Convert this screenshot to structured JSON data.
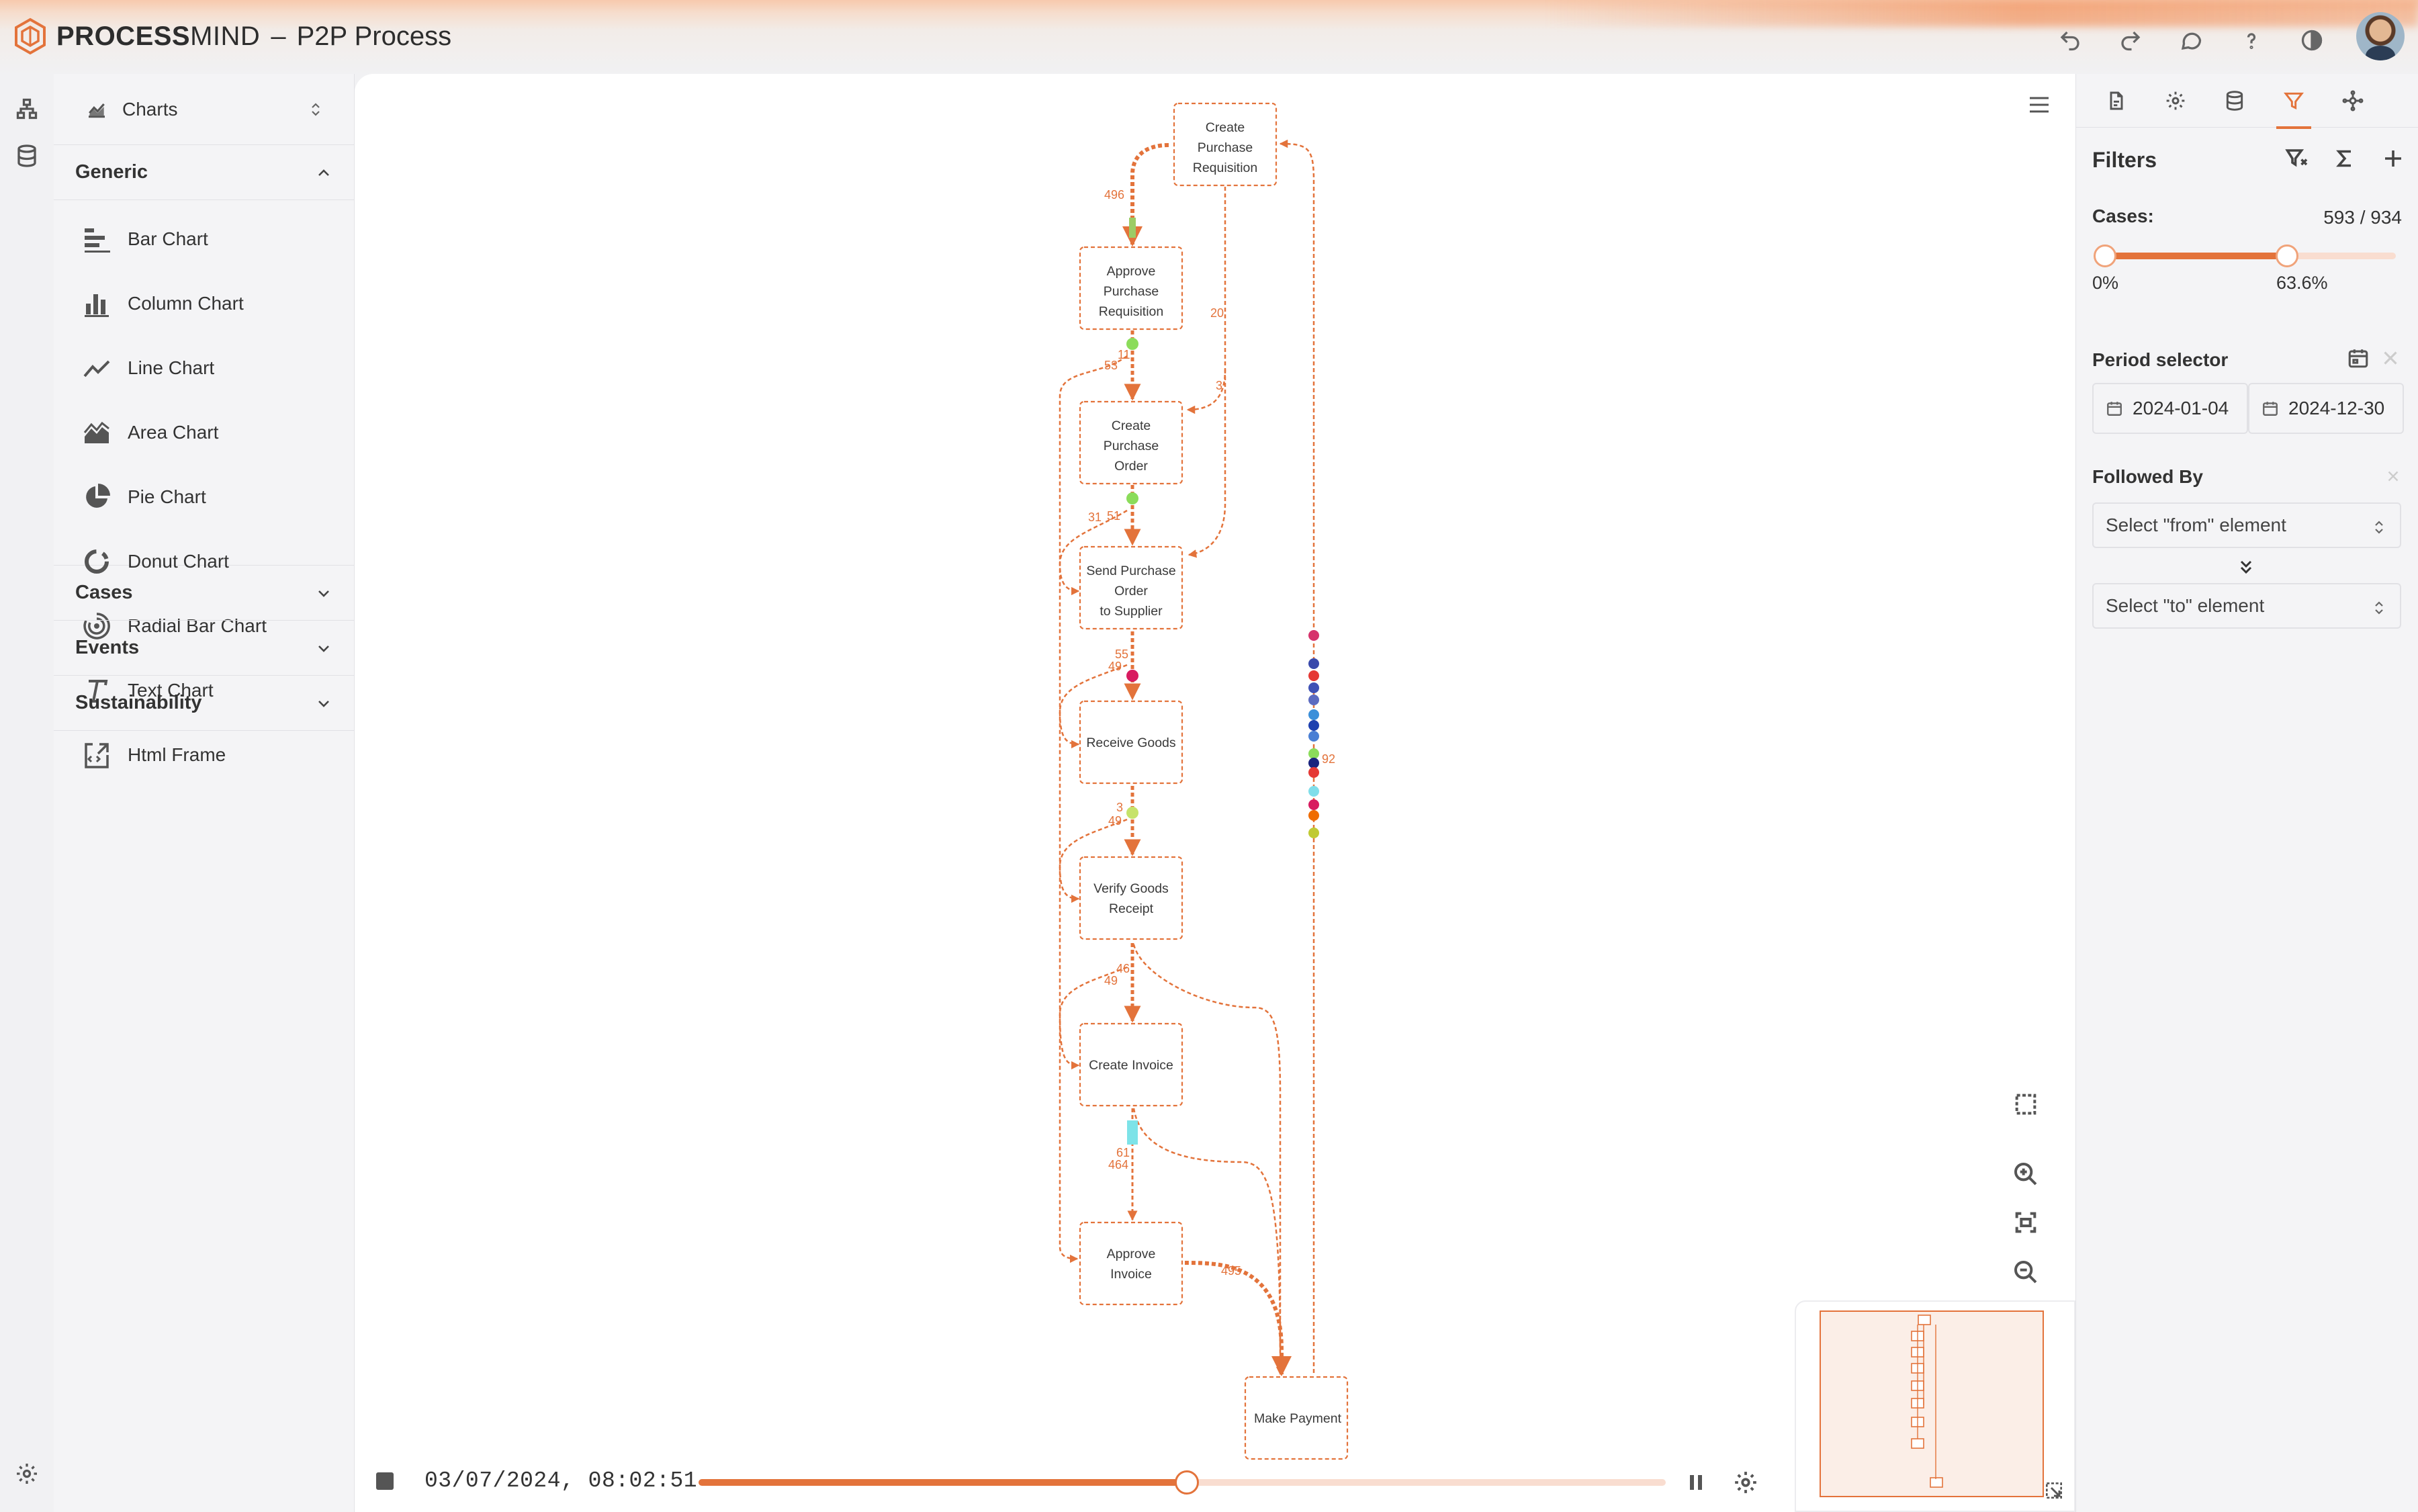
{
  "app": {
    "brand_bold": "PROCESS",
    "brand_rest": "MIND",
    "separator": "–",
    "title": "P2P Process"
  },
  "header_icons": [
    "undo-icon",
    "redo-icon",
    "comment-icon",
    "help-icon",
    "theme-icon"
  ],
  "sidebar": {
    "selector_label": "Charts",
    "generic_title": "Generic",
    "generic_items": [
      {
        "label": "Bar Chart",
        "icon": "bar-chart-icon"
      },
      {
        "label": "Column Chart",
        "icon": "column-chart-icon"
      },
      {
        "label": "Line Chart",
        "icon": "line-chart-icon"
      },
      {
        "label": "Area Chart",
        "icon": "area-chart-icon"
      },
      {
        "label": "Pie Chart",
        "icon": "pie-chart-icon"
      },
      {
        "label": "Donut Chart",
        "icon": "donut-chart-icon"
      },
      {
        "label": "Radial Bar Chart",
        "icon": "radial-bar-chart-icon"
      },
      {
        "label": "Text Chart",
        "icon": "text-chart-icon"
      },
      {
        "label": "Html Frame",
        "icon": "html-frame-icon"
      }
    ],
    "sections": [
      "Cases",
      "Events",
      "Sustainability"
    ]
  },
  "process_map": {
    "nodes": {
      "create_pr": [
        "Create",
        "Purchase",
        "Requisition"
      ],
      "approve_pr": [
        "Approve",
        "Purchase",
        "Requisition"
      ],
      "create_po": [
        "Create",
        "Purchase",
        "Order"
      ],
      "send_po": [
        "Send Purchase",
        "Order",
        "to Supplier"
      ],
      "receive": [
        "Receive Goods"
      ],
      "verify": [
        "Verify Goods",
        "Receipt"
      ],
      "invoice": [
        "Create Invoice"
      ],
      "approve_inv": [
        "Approve",
        "Invoice"
      ],
      "payment": [
        "Make Payment"
      ]
    },
    "edge_labels": {
      "e1": "496",
      "e2": "20",
      "e3": "3",
      "e4": "11",
      "e5": "53",
      "e6": "31",
      "e7": "51",
      "e8": "55",
      "e9": "49",
      "e10": "3",
      "e11": "49",
      "e12": "46",
      "e13": "49",
      "e14": "61",
      "e15": "464",
      "e16": "495",
      "e17": "92"
    }
  },
  "playback": {
    "timestamp": "03/07/2024, 08:02:51",
    "progress": 0.505
  },
  "panel": {
    "title": "Filters",
    "cases_label": "Cases:",
    "cases_value": "593 / 934",
    "cases_min_pct": "0%",
    "cases_max_pct": "63.6%",
    "cases_range": [
      0,
      0.636
    ],
    "period_label": "Period selector",
    "date_from": "2024-01-04",
    "date_to": "2024-12-30",
    "followed_label": "Followed By",
    "from_placeholder": "Select \"from\" element",
    "to_placeholder": "Select \"to\" element"
  },
  "colors": {
    "accent": "#e3733b",
    "accent_light": "#f9ddd0"
  }
}
